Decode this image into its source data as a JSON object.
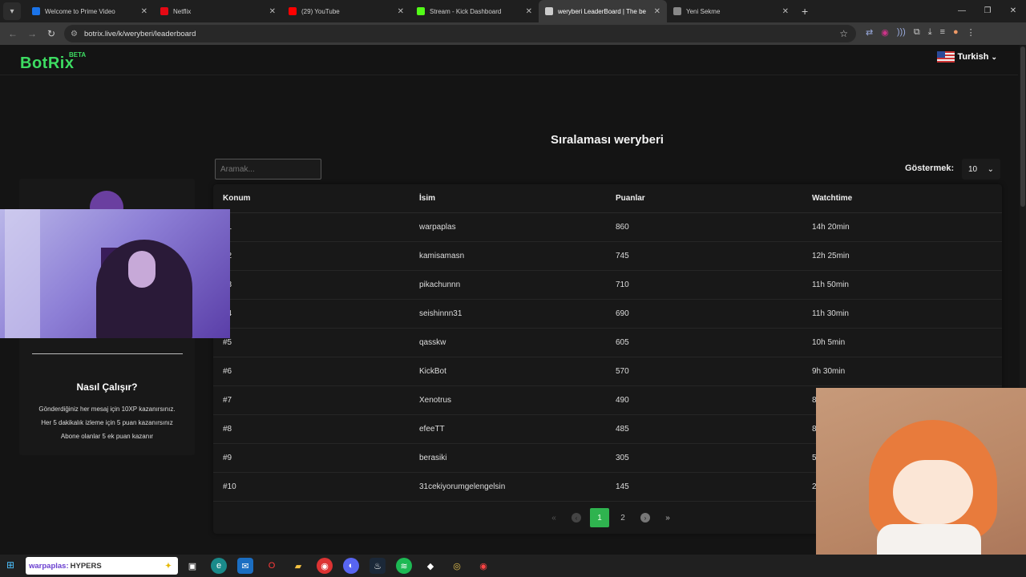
{
  "browser": {
    "tabs": [
      {
        "label": "Welcome to Prime Video",
        "icon": "prime-video-icon",
        "color": "#1a73e8"
      },
      {
        "label": "Netflix",
        "icon": "netflix-icon",
        "color": "#e50914"
      },
      {
        "label": "(29) YouTube",
        "icon": "youtube-icon",
        "color": "#ff0000"
      },
      {
        "label": "Stream - Kick Dashboard",
        "icon": "kick-icon",
        "color": "#53fc18"
      },
      {
        "label": "weryberi LeaderBoard | The be",
        "icon": "botrix-icon",
        "color": "#cccccc"
      },
      {
        "label": "Yeni Sekme",
        "icon": "chrome-icon",
        "color": "#888888"
      }
    ],
    "url": "botrix.live/k/weryberi/leaderboard"
  },
  "site": {
    "logo": "BotRix",
    "beta": "BETA",
    "language": "Turkish"
  },
  "leaderboard": {
    "title": "Sıralaması weryberi",
    "search_placeholder": "Aramak...",
    "show_label": "Göstermek:",
    "show_value": "10",
    "columns": [
      "Konum",
      "İsim",
      "Puanlar",
      "Watchtime"
    ],
    "rows": [
      {
        "rank": "#1",
        "name": "warpaplas",
        "points": "860",
        "watchtime": "14h 20min"
      },
      {
        "rank": "#2",
        "name": "kamisamasn",
        "points": "745",
        "watchtime": "12h 25min"
      },
      {
        "rank": "#3",
        "name": "pikachunnn",
        "points": "710",
        "watchtime": "11h 50min"
      },
      {
        "rank": "#4",
        "name": "seishinnn31",
        "points": "690",
        "watchtime": "11h 30min"
      },
      {
        "rank": "#5",
        "name": "qasskw",
        "points": "605",
        "watchtime": "10h 5min"
      },
      {
        "rank": "#6",
        "name": "KickBot",
        "points": "570",
        "watchtime": "9h 30min"
      },
      {
        "rank": "#7",
        "name": "Xenotrus",
        "points": "490",
        "watchtime": "8"
      },
      {
        "rank": "#8",
        "name": "efeeTT",
        "points": "485",
        "watchtime": "8"
      },
      {
        "rank": "#9",
        "name": "berasiki",
        "points": "305",
        "watchtime": "5"
      },
      {
        "rank": "#10",
        "name": "31cekiyorumgelengelsin",
        "points": "145",
        "watchtime": "2"
      }
    ],
    "pagination": {
      "current": "1",
      "next": "2"
    }
  },
  "sidebar": {
    "title": "Nasıl Çalışır?",
    "lines": [
      "Gönderdiğiniz her mesaj için 10XP kazanırsınız.",
      "Her 5 dakikalık izleme için 5 puan kazanırsınız",
      "Abone olanlar 5 ek puan kazanır"
    ]
  },
  "taskbar": {
    "search_user": "warpaplas:",
    "search_text": "HYPERS"
  }
}
